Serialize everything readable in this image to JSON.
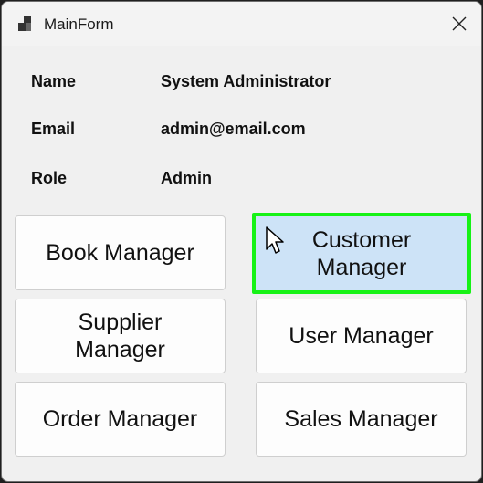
{
  "window": {
    "title": "MainForm",
    "app_icon": "windows-forms-icon",
    "close_icon": "close-icon"
  },
  "user_info": {
    "name_label": "Name",
    "name_value": "System Administrator",
    "email_label": "Email",
    "email_value": "admin@email.com",
    "role_label": "Role",
    "role_value": "Admin"
  },
  "buttons": {
    "book": "Book Manager",
    "customer": "Customer Manager",
    "supplier": "Supplier Manager",
    "user": "User Manager",
    "order": "Order Manager",
    "sales": "Sales Manager"
  },
  "colors": {
    "focus_border": "#17f216",
    "hover_background": "#cde3f7"
  }
}
